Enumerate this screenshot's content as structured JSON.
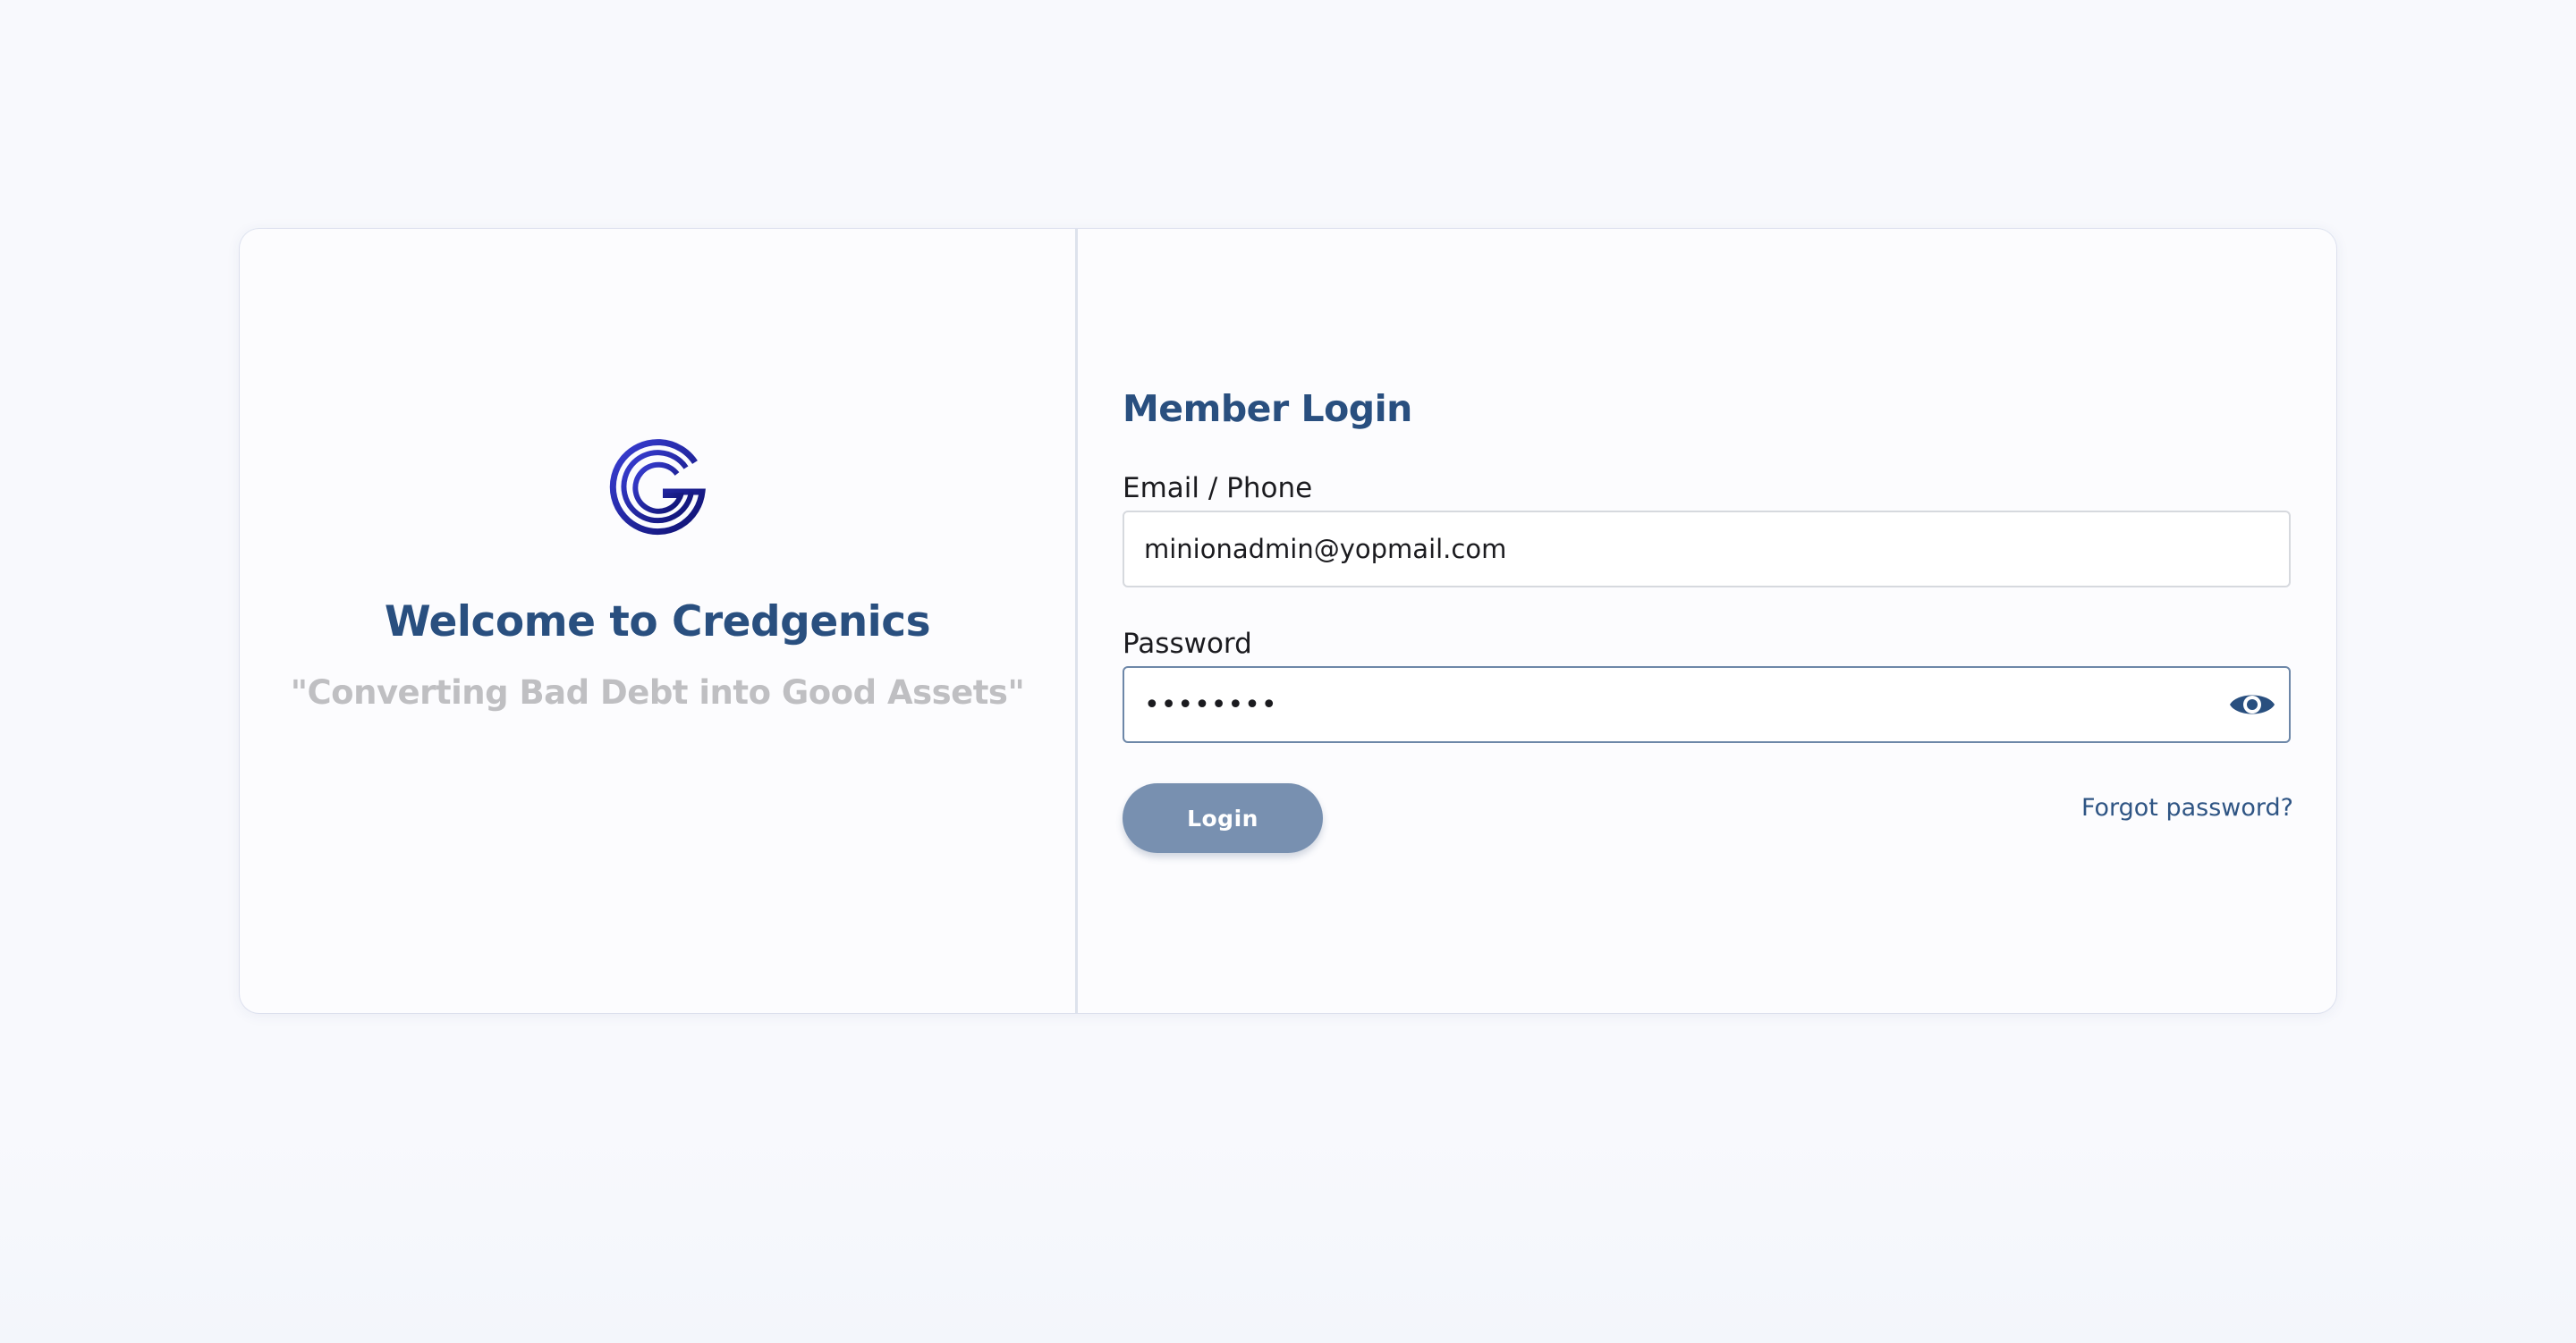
{
  "brand": {
    "welcome_title": "Welcome to Credgenics",
    "tagline": "\"Converting Bad Debt into Good Assets\"",
    "logo_icon": "credgenics-g-logo-icon",
    "logo_color_light": "#3a3fd6",
    "logo_color_dark": "#0e1170"
  },
  "login": {
    "heading": "Member Login",
    "email_label": "Email / Phone",
    "email_value": "minionadmin@yopmail.com",
    "password_label": "Password",
    "password_value": "••••••••",
    "show_password_icon": "eye-icon",
    "login_button_label": "Login",
    "forgot_password_label": "Forgot password?"
  },
  "colors": {
    "primary": "#294f7f",
    "button": "#7890b0",
    "tagline": "#bfbfc2"
  }
}
